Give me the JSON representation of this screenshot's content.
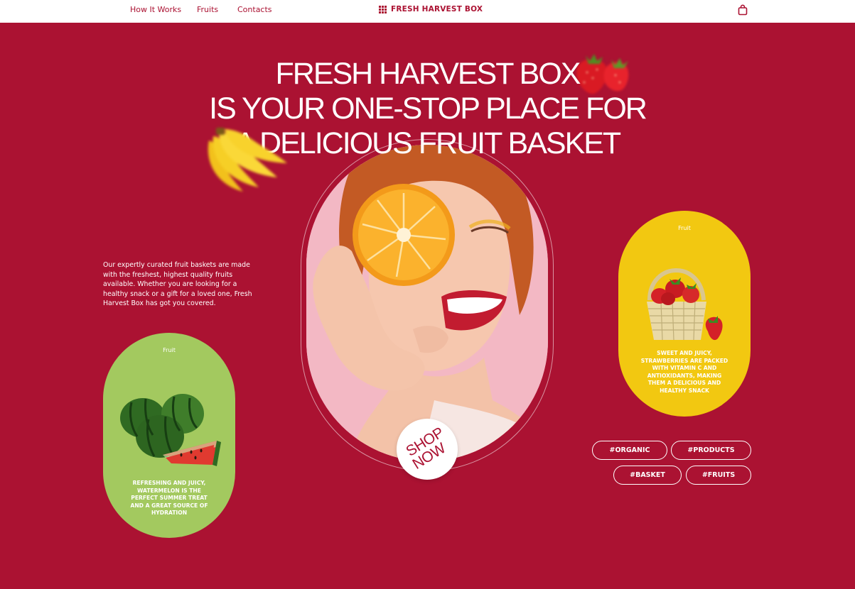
{
  "nav": {
    "links": [
      "How It Works",
      "Fruits",
      "Contacts"
    ],
    "brand": "FRESH HARVEST BOX",
    "brand_icon": "grid-icon",
    "cart_icon": "shopping-bag-icon"
  },
  "hero": {
    "headline_lines": [
      "FRESH HARVEST BOX",
      "IS YOUR ONE-STOP PLACE FOR",
      "A DELICIOUS FRUIT BASKET"
    ],
    "intro": "Our expertly curated fruit baskets are made with the freshest, highest quality fruits available. Whether you are looking for a healthy snack or a gift for a loved one, Fresh Harvest Box has got you covered.",
    "cta_lines": [
      "SHOP",
      "NOW"
    ]
  },
  "cards": [
    {
      "label": "Fruit",
      "text": "REFRESHING AND JUICY, WATERMELON IS THE PERFECT SUMMER TREAT AND A GREAT SOURCE OF HYDRATION",
      "color": "#a3c95f"
    },
    {
      "label": "Fruit",
      "text": "SWEET AND JUICY, STRAWBERRIES ARE PACKED WITH VITAMIN C AND ANTIOXIDANTS, MAKING THEM A DELICIOUS AND HEALTHY SNACK",
      "color": "#f2c811"
    }
  ],
  "tags": [
    "#ORGANIC",
    "#PRODUCTS",
    "#BASKET",
    "#FRUITS"
  ],
  "colors": {
    "brand": "#ab1232",
    "nav_bg": "#ffffff",
    "card_green": "#a3c95f",
    "card_yellow": "#f2c811"
  }
}
